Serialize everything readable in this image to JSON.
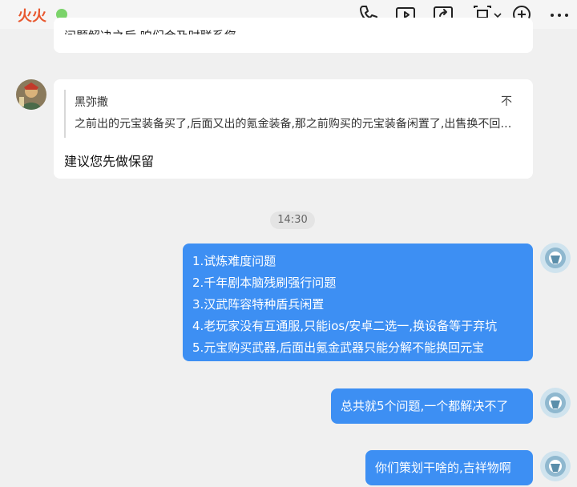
{
  "header": {
    "contact_name": "火火",
    "status_color": "#7bd36a",
    "icons": [
      "phone-icon",
      "video-icon",
      "screen-share-icon",
      "remote-assist-icon",
      "add-icon",
      "more-icon"
    ]
  },
  "messages": {
    "partial_text": "问题解决之后,咱们会及时联系您",
    "quote": {
      "author": "黑弥撒",
      "text": "之前出的元宝装备买了,后面又出的氪金装备,那之前购买的元宝装备闲置了,出售换不回元宝",
      "expand": "不"
    },
    "reply": "建议您先做保留",
    "timestamp": "14:30",
    "outgoing": [
      {
        "lines": [
          "1.试炼难度问题",
          "2.千年剧本脑残刷强行问题",
          "3.汉武阵容特种盾兵闲置",
          "4.老玩家没有互通服,只能ios/安卓二选一,换设备等于弃坑",
          "5.元宝购买武器,后面出氪金武器只能分解不能换回元宝"
        ]
      },
      {
        "lines": [
          "总共就5个问题,一个都解决不了"
        ]
      },
      {
        "lines": [
          "你们策划干啥的,吉祥物啊"
        ]
      }
    ]
  },
  "colors": {
    "accent_name": "#e8572e",
    "outgoing_bubble": "#3d8ff3",
    "incoming_bubble": "#ffffff",
    "background": "#f0f0f0"
  }
}
